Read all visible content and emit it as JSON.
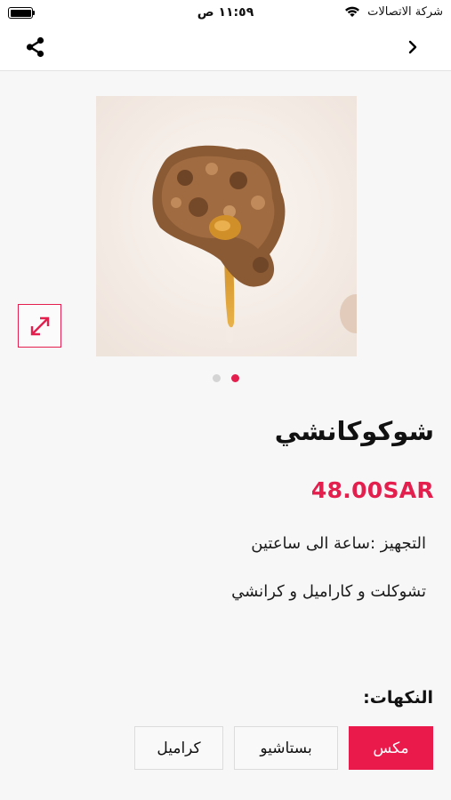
{
  "status_bar": {
    "time": "١١:٥٩ ص",
    "carrier": "شركة الاتصالات",
    "icons": [
      "battery-icon",
      "wifi-icon"
    ]
  },
  "nav": {
    "icons": [
      "share-icon",
      "chevron-back-icon"
    ]
  },
  "product": {
    "image_icon": "expand-icon",
    "carousel_dots": 2,
    "carousel_active_index": 1,
    "title": "شوكوكانشي",
    "price": "48.00SAR",
    "description_lines": [
      "التجهيز :ساعة الى ساعتين",
      "تشوكلت و كاراميل و كرانشي"
    ]
  },
  "flavors": {
    "label": "النكهات:",
    "options": [
      "مكس",
      "بستاشيو",
      "كراميل"
    ],
    "selected": "مكس"
  },
  "colors": {
    "accent": "#e41e4d",
    "selected_button": "#ea1b4b",
    "background": "#f7f7f7"
  }
}
